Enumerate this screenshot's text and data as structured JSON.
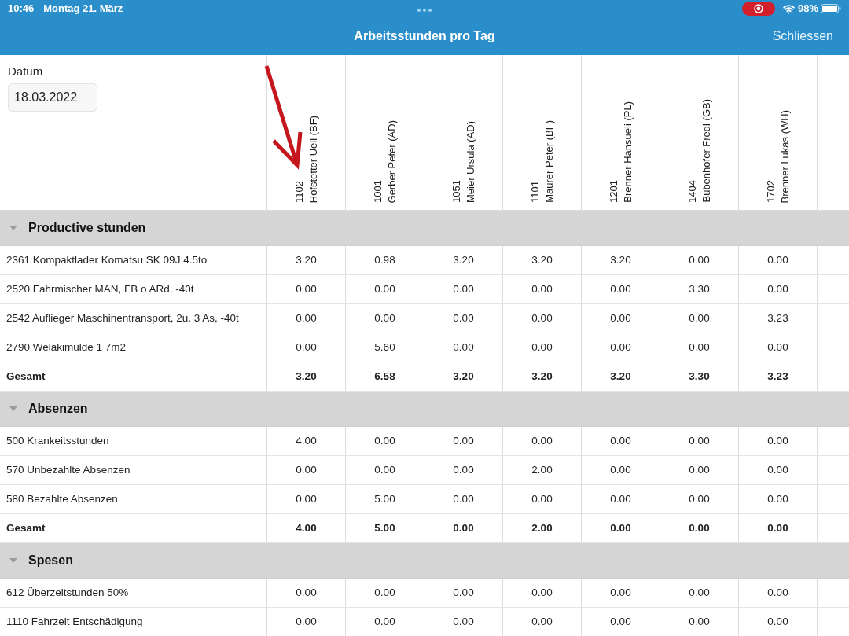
{
  "status_bar": {
    "time": "10:46",
    "date": "Montag 21. März",
    "battery": "98%"
  },
  "nav_bar": {
    "title": "Arbeitsstunden pro Tag",
    "close_button": "Schliessen"
  },
  "date_filter": {
    "label": "Datum",
    "value": "18.03.2022"
  },
  "columns": [
    {
      "number": "1102",
      "name": "Hofstetter Ueli (BF)"
    },
    {
      "number": "1001",
      "name": "Gerber Peter (AD)"
    },
    {
      "number": "1051",
      "name": "Meier Ursula (AD)"
    },
    {
      "number": "1101",
      "name": "Maurer Peter (BF)"
    },
    {
      "number": "1201",
      "name": "Brenner Hansueli (PL)"
    },
    {
      "number": "1404",
      "name": "Bubenhofer Fredi (GB)"
    },
    {
      "number": "1702",
      "name": "Brenner Lukas (WH)"
    }
  ],
  "sections": [
    {
      "title": "Productive stunden",
      "expanded": true,
      "rows": [
        {
          "kind": "item",
          "label": "2361 Kompaktlader Komatsu SK 09J 4.5to",
          "values": [
            "3.20",
            "0.98",
            "3.20",
            "3.20",
            "3.20",
            "0.00",
            "0.00"
          ]
        },
        {
          "kind": "item",
          "label": "2520 Fahrmischer MAN, FB o ARd, -40t",
          "values": [
            "0.00",
            "0.00",
            "0.00",
            "0.00",
            "0.00",
            "3.30",
            "0.00"
          ]
        },
        {
          "kind": "item",
          "label": "2542 Auflieger Maschinentransport, 2u. 3 As, -40t",
          "values": [
            "0.00",
            "0.00",
            "0.00",
            "0.00",
            "0.00",
            "0.00",
            "3.23"
          ]
        },
        {
          "kind": "item",
          "label": "2790 Welakimulde 1 7m2",
          "values": [
            "0.00",
            "5.60",
            "0.00",
            "0.00",
            "0.00",
            "0.00",
            "0.00"
          ]
        },
        {
          "kind": "total",
          "label": "Gesamt",
          "values": [
            "3.20",
            "6.58",
            "3.20",
            "3.20",
            "3.20",
            "3.30",
            "3.23"
          ]
        }
      ]
    },
    {
      "title": "Absenzen",
      "expanded": true,
      "rows": [
        {
          "kind": "item",
          "label": "500 Krankeitsstunden",
          "values": [
            "4.00",
            "0.00",
            "0.00",
            "0.00",
            "0.00",
            "0.00",
            "0.00"
          ]
        },
        {
          "kind": "item",
          "label": "570 Unbezahlte Absenzen",
          "values": [
            "0.00",
            "0.00",
            "0.00",
            "2.00",
            "0.00",
            "0.00",
            "0.00"
          ]
        },
        {
          "kind": "item",
          "label": "580 Bezahlte Absenzen",
          "values": [
            "0.00",
            "5.00",
            "0.00",
            "0.00",
            "0.00",
            "0.00",
            "0.00"
          ]
        },
        {
          "kind": "total",
          "label": "Gesamt",
          "values": [
            "4.00",
            "5.00",
            "0.00",
            "2.00",
            "0.00",
            "0.00",
            "0.00"
          ]
        }
      ]
    },
    {
      "title": "Spesen",
      "expanded": true,
      "rows": [
        {
          "kind": "item",
          "label": "612 Überzeitstunden 50%",
          "values": [
            "0.00",
            "0.00",
            "0.00",
            "0.00",
            "0.00",
            "0.00",
            "0.00"
          ]
        },
        {
          "kind": "item",
          "label": "1110 Fahrzeit Entschädigung",
          "values": [
            "0.00",
            "0.00",
            "0.00",
            "0.00",
            "0.00",
            "0.00",
            "0.00"
          ]
        }
      ]
    }
  ]
}
